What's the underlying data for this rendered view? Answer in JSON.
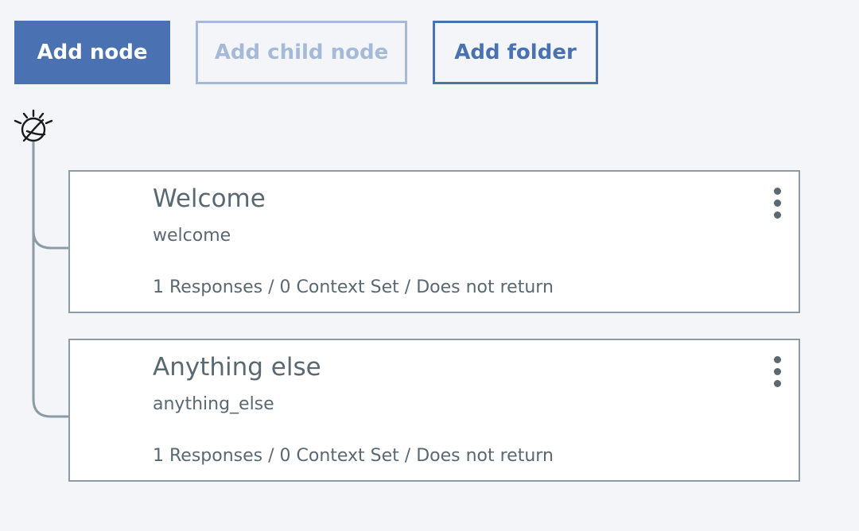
{
  "toolbar": {
    "add_node_label": "Add node",
    "add_child_node_label": "Add child node",
    "add_folder_label": "Add folder"
  },
  "tree": {
    "root_icon": "watson-assistant-icon",
    "nodes": [
      {
        "title": "Welcome",
        "condition": "welcome",
        "summary": "1 Responses / 0 Context Set / Does not return",
        "menu_icon": "overflow-menu-icon"
      },
      {
        "title": "Anything else",
        "condition": "anything_else",
        "summary": "1 Responses / 0 Context Set / Does not return",
        "menu_icon": "overflow-menu-icon"
      }
    ]
  },
  "colors": {
    "primary": "#4a72b2",
    "primary_disabled": "#a6bad8",
    "background": "#f3f5f9",
    "text": "#5a6872",
    "connector": "#8c9ba5"
  }
}
